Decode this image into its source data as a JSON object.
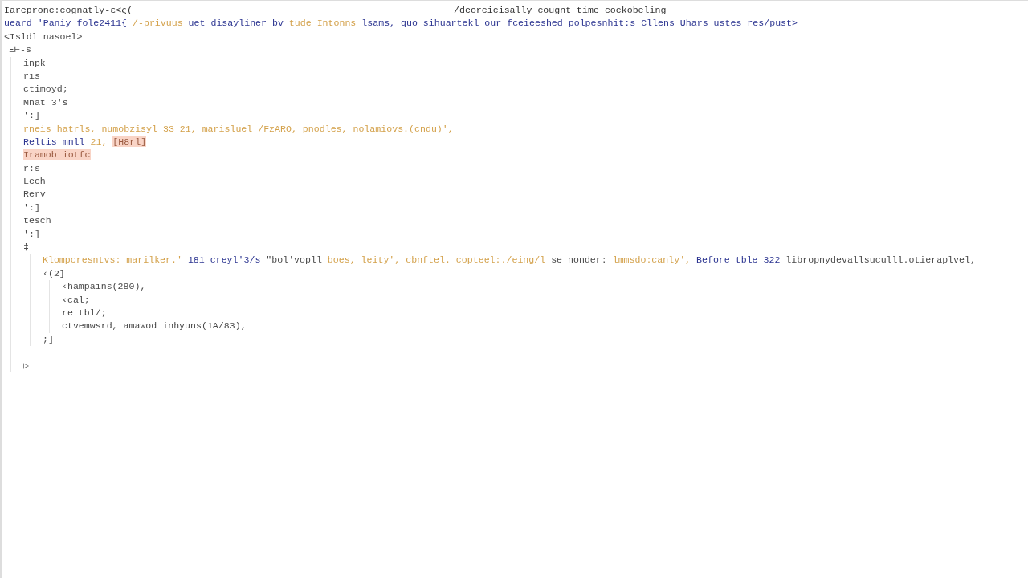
{
  "title": {
    "left": "Iarepronc:cognatly-ε<ς(",
    "center": "/deorcicisally cougnt time cockobeling"
  },
  "lines": [
    {
      "segments": [
        {
          "kind": "keyword",
          "text": "ueard 'Paniy fole2411{ "
        },
        {
          "kind": "string",
          "text": "/-privuus "
        },
        {
          "kind": "keyword",
          "text": "uet disayliner bv "
        },
        {
          "kind": "string",
          "text": "tude Intonns "
        },
        {
          "kind": "keyword",
          "text": "lsams, quo sihuartekl our fceieeshed polpesnhit:s Cllens Uhars ustes res/pust>"
        }
      ]
    },
    {
      "segments": [
        {
          "kind": "plain",
          "text": "<Isldl nasoel>"
        }
      ]
    },
    {
      "segments": [
        {
          "kind": "plain",
          "text": "Ξ⊢-s"
        }
      ],
      "children": [
        {
          "segments": [
            {
              "kind": "plain",
              "text": "inpk"
            }
          ]
        },
        {
          "segments": [
            {
              "kind": "plain",
              "text": "rıs"
            }
          ]
        },
        {
          "segments": [
            {
              "kind": "plain",
              "text": "ctimoyd;"
            }
          ]
        },
        {
          "segments": [
            {
              "kind": "plain",
              "text": "Mnat 3's"
            }
          ]
        },
        {
          "segments": [
            {
              "kind": "plain",
              "text": "':]"
            }
          ]
        },
        {
          "segments": [
            {
              "kind": "string",
              "text": "rneis hatrls, numobzisyl 33 21, marisluel /FzARO, pnodles, nolamiovs.(cndu)',"
            }
          ]
        },
        {
          "segments": [
            {
              "kind": "keyword",
              "text": "Reltis mnll "
            },
            {
              "kind": "string",
              "text": "21,_"
            },
            {
              "kind": "highlight",
              "text": "[H8rl]"
            }
          ]
        },
        {
          "segments": [
            {
              "kind": "highlight",
              "text": "Iramob iotfc"
            }
          ]
        },
        {
          "segments": [
            {
              "kind": "plain",
              "text": "r:s"
            }
          ]
        },
        {
          "segments": [
            {
              "kind": "plain",
              "text": "Lech"
            }
          ]
        },
        {
          "segments": [
            {
              "kind": "plain",
              "text": "Rerv"
            }
          ]
        },
        {
          "segments": [
            {
              "kind": "plain",
              "text": "':]"
            }
          ]
        },
        {
          "segments": [
            {
              "kind": "plain",
              "text": "tesch"
            }
          ]
        },
        {
          "segments": [
            {
              "kind": "plain",
              "text": "':]"
            }
          ]
        },
        {
          "segments": [
            {
              "kind": "plain",
              "text": "‡"
            }
          ],
          "children": [
            {
              "segments": [
                {
                  "kind": "string",
                  "text": "Klompcresntvs: marilker.'"
                },
                {
                  "kind": "keyword",
                  "text": "_181 creyl'3/s "
                },
                {
                  "kind": "plain",
                  "text": "\"bol'vopll "
                },
                {
                  "kind": "string",
                  "text": "boes, leity', cbnftel. copteel:./eing/l "
                },
                {
                  "kind": "plain",
                  "text": "se nonder: "
                },
                {
                  "kind": "string",
                  "text": "lmmsdo:canly',"
                },
                {
                  "kind": "keyword",
                  "text": "_Before tble 322 "
                },
                {
                  "kind": "plain",
                  "text": "libropnydevallsuculll.otieraplvel,"
                }
              ]
            },
            {
              "segments": [
                {
                  "kind": "plain",
                  "text": "‹(2]"
                }
              ],
              "children": [
                {
                  "segments": [
                    {
                      "kind": "plain",
                      "text": "‹hampains(280),"
                    }
                  ]
                },
                {
                  "segments": [
                    {
                      "kind": "plain",
                      "text": "‹cal;"
                    }
                  ]
                },
                {
                  "segments": [
                    {
                      "kind": "plain",
                      "text": "re tbl/;"
                    }
                  ]
                },
                {
                  "segments": [
                    {
                      "kind": "plain",
                      "text": "ctvemwsrd, amawod inhyuns(1A/83),"
                    }
                  ]
                }
              ]
            },
            {
              "segments": [
                {
                  "kind": "plain",
                  "text": ";]"
                }
              ]
            }
          ]
        },
        {
          "segments": [
            {
              "kind": "plain",
              "text": "▷"
            }
          ],
          "blank_before": true
        }
      ]
    }
  ]
}
